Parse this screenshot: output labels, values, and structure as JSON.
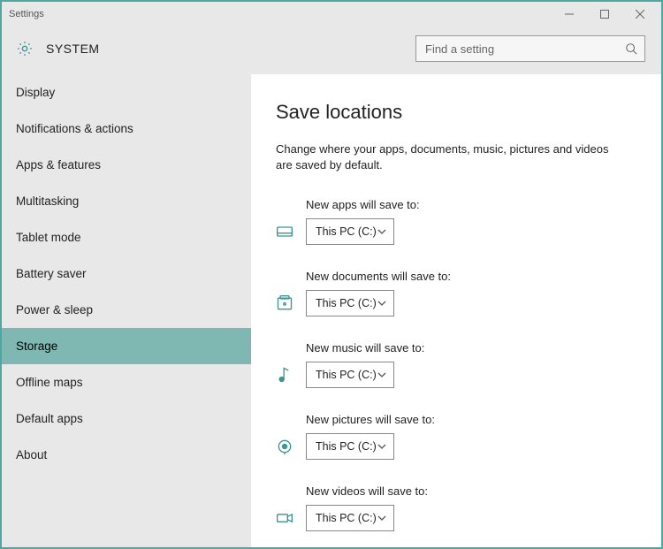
{
  "window": {
    "title": "Settings"
  },
  "header": {
    "section": "SYSTEM",
    "search_placeholder": "Find a setting"
  },
  "sidebar": {
    "selected_index": 6,
    "items": [
      {
        "label": "Display"
      },
      {
        "label": "Notifications & actions"
      },
      {
        "label": "Apps & features"
      },
      {
        "label": "Multitasking"
      },
      {
        "label": "Tablet mode"
      },
      {
        "label": "Battery saver"
      },
      {
        "label": "Storage"
      },
      {
        "label": "Power & sleep"
      },
      {
        "label": "Offline maps"
      },
      {
        "label": "Default apps"
      },
      {
        "label": "About"
      }
    ]
  },
  "main": {
    "title": "Save locations",
    "description": "Change where your apps, documents, music, pictures and videos are saved by default.",
    "settings": [
      {
        "label": "New apps will save to:",
        "value": "This PC (C:)",
        "icon": "apps"
      },
      {
        "label": "New documents will save to:",
        "value": "This PC (C:)",
        "icon": "documents"
      },
      {
        "label": "New music will save to:",
        "value": "This PC (C:)",
        "icon": "music"
      },
      {
        "label": "New pictures will save to:",
        "value": "This PC (C:)",
        "icon": "pictures"
      },
      {
        "label": "New videos will save to:",
        "value": "This PC (C:)",
        "icon": "videos"
      }
    ]
  }
}
